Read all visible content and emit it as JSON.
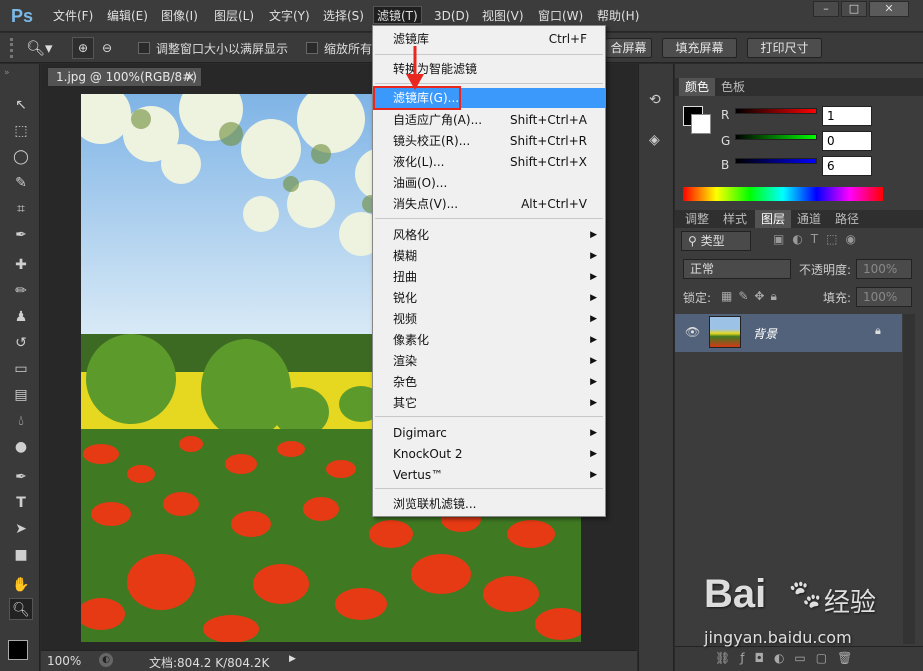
{
  "app": {
    "logo": "Ps"
  },
  "menubar": {
    "items": [
      "文件(F)",
      "编辑(E)",
      "图像(I)",
      "图层(L)",
      "文字(Y)",
      "选择(S)",
      "滤镜(T)",
      "3D(D)",
      "视图(V)",
      "窗口(W)",
      "帮助(H)"
    ],
    "active": "滤镜(T)",
    "window_buttons": [
      "–",
      "□",
      "✕"
    ]
  },
  "options": {
    "checkbox1_label": "调整窗口大小以满屏显示",
    "checkbox2_label": "缩放所有",
    "btn_fit": "合屏幕",
    "btn_fill": "填充屏幕",
    "btn_print": "打印尺寸"
  },
  "document": {
    "tab_title": "1.jpg @ 100%(RGB/8#)",
    "tab_close": "×",
    "zoom": "100%",
    "doc_info": "文档:804.2 K/804.2K"
  },
  "filter_menu": {
    "items": [
      {
        "label": "滤镜库",
        "shortcut": "Ctrl+F"
      },
      {
        "label": "转换为智能滤镜"
      },
      {
        "label": "滤镜库(G)...",
        "highlighted": true
      },
      {
        "label": "自适应广角(A)...",
        "shortcut": "Shift+Ctrl+A"
      },
      {
        "label": "镜头校正(R)...",
        "shortcut": "Shift+Ctrl+R"
      },
      {
        "label": "液化(L)...",
        "shortcut": "Shift+Ctrl+X"
      },
      {
        "label": "油画(O)..."
      },
      {
        "label": "消失点(V)...",
        "shortcut": "Alt+Ctrl+V"
      },
      {
        "label": "风格化",
        "submenu": true
      },
      {
        "label": "模糊",
        "submenu": true
      },
      {
        "label": "扭曲",
        "submenu": true
      },
      {
        "label": "锐化",
        "submenu": true
      },
      {
        "label": "视频",
        "submenu": true
      },
      {
        "label": "像素化",
        "submenu": true
      },
      {
        "label": "渲染",
        "submenu": true
      },
      {
        "label": "杂色",
        "submenu": true
      },
      {
        "label": "其它",
        "submenu": true
      },
      {
        "label": "Digimarc",
        "submenu": true
      },
      {
        "label": "KnockOut 2",
        "submenu": true
      },
      {
        "label": "Vertus™",
        "submenu": true
      },
      {
        "label": "浏览联机滤镜..."
      }
    ]
  },
  "color_panel": {
    "tabs": [
      "颜色",
      "色板"
    ],
    "r_label": "R",
    "r_value": "1",
    "g_label": "G",
    "g_value": "0",
    "b_label": "B",
    "b_value": "6"
  },
  "layers_panel": {
    "tabs": [
      "调整",
      "样式",
      "图层",
      "通道",
      "路径"
    ],
    "active_tab": "图层",
    "filter_type": "类型",
    "blend_mode": "正常",
    "opacity_label": "不透明度:",
    "opacity_value": "100%",
    "lock_label": "锁定:",
    "fill_label": "填充:",
    "fill_value": "100%",
    "layer_name": "背景"
  },
  "watermark": {
    "brand": "Bai",
    "brand_cn": "经验",
    "url": "jingyan.baidu.com"
  },
  "colors": {
    "highlight": "#3b99fc",
    "annotation_red": "#e8281e"
  }
}
